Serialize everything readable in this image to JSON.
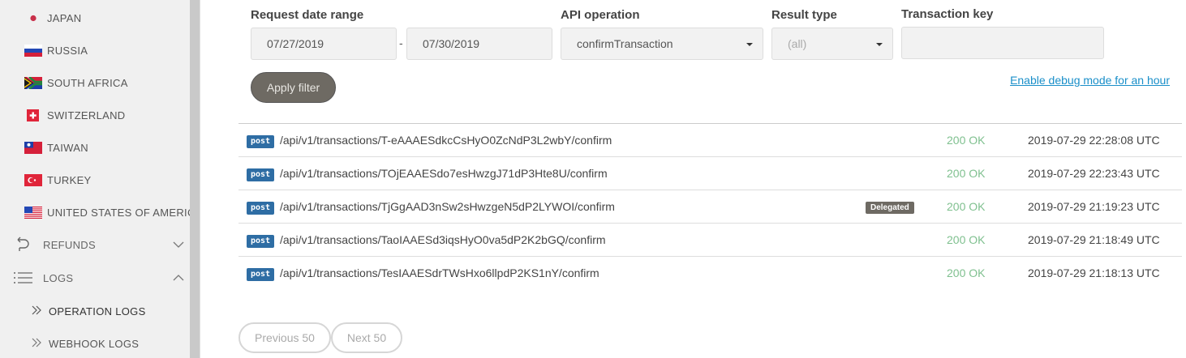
{
  "sidebar": {
    "countries": [
      {
        "label": "JAPAN",
        "flag": "japan-flag-icon"
      },
      {
        "label": "RUSSIA",
        "flag": "russia-flag-icon"
      },
      {
        "label": "SOUTH AFRICA",
        "flag": "south-africa-flag-icon"
      },
      {
        "label": "SWITZERLAND",
        "flag": "switzerland-flag-icon"
      },
      {
        "label": "TAIWAN",
        "flag": "taiwan-flag-icon"
      },
      {
        "label": "TURKEY",
        "flag": "turkey-flag-icon"
      },
      {
        "label": "UNITED STATES OF AMERICA",
        "flag": "usa-flag-icon"
      }
    ],
    "refunds": {
      "label": "REFUNDS",
      "icon": "refund-arrow-icon",
      "chevron": "chevron-down-icon"
    },
    "logs": {
      "label": "LOGS",
      "icon": "list-icon",
      "chevron": "chevron-up-icon"
    },
    "sub_items": [
      {
        "label": "OPERATION LOGS",
        "icon": "double-chevron-right-icon"
      },
      {
        "label": "WEBHOOK LOGS",
        "icon": "double-chevron-right-icon"
      }
    ]
  },
  "filters": {
    "date_range_label": "Request date range",
    "date_from": "07/27/2019",
    "date_separator": "-",
    "date_to": "07/30/2019",
    "api_operation_label": "API operation",
    "api_operation_value": "confirmTransaction",
    "result_type_label": "Result type",
    "result_type_value": "(all)",
    "transaction_key_label": "Transaction key",
    "transaction_key_value": "",
    "apply_label": "Apply filter",
    "debug_link": "Enable debug mode for an hour"
  },
  "logs": [
    {
      "method": "post",
      "path": "/api/v1/transactions/T-eAAAESdkcCsHyO0ZcNdP3L2wbY/confirm",
      "tag": "",
      "status": "200 OK",
      "time": "2019-07-29 22:28:08 UTC"
    },
    {
      "method": "post",
      "path": "/api/v1/transactions/TOjEAAESdo7esHwzgJ71dP3Hte8U/confirm",
      "tag": "",
      "status": "200 OK",
      "time": "2019-07-29 22:23:43 UTC"
    },
    {
      "method": "post",
      "path": "/api/v1/transactions/TjGgAAD3nSw2sHwzgeN5dP2LYWOI/confirm",
      "tag": "Delegated",
      "status": "200 OK",
      "time": "2019-07-29 21:19:23 UTC"
    },
    {
      "method": "post",
      "path": "/api/v1/transactions/TaoIAAESd3iqsHyO0va5dP2K2bGQ/confirm",
      "tag": "",
      "status": "200 OK",
      "time": "2019-07-29 21:18:49 UTC"
    },
    {
      "method": "post",
      "path": "/api/v1/transactions/TesIAAESdrTWsHxo6llpdP2KS1nY/confirm",
      "tag": "",
      "status": "200 OK",
      "time": "2019-07-29 21:18:13 UTC"
    }
  ],
  "pager": {
    "prev_label": "Previous 50",
    "next_label": "Next 50"
  },
  "colors": {
    "status_ok": "#7fc08f",
    "post_badge": "#2e6da4",
    "link": "#1a8fc9"
  }
}
